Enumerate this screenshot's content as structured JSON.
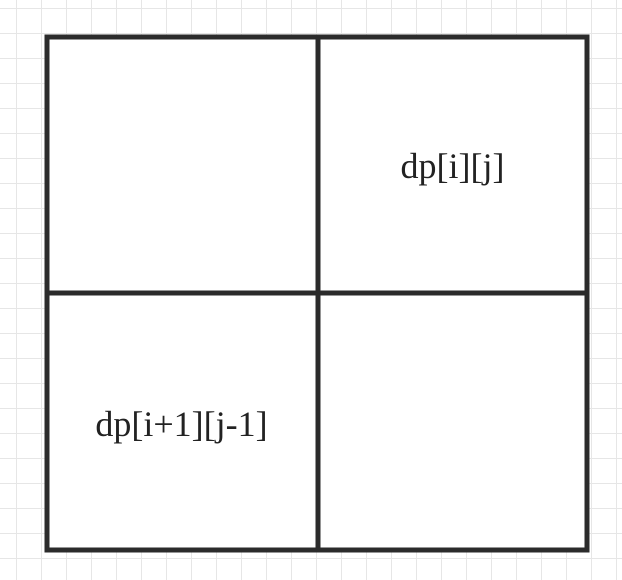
{
  "grid": {
    "cells": [
      {
        "label": ""
      },
      {
        "label": "dp[i][j]"
      },
      {
        "label": "dp[i+1][j-1]"
      },
      {
        "label": ""
      }
    ],
    "line_color": "#2b2b2b",
    "background_grid_color": "#e6e6e6"
  }
}
